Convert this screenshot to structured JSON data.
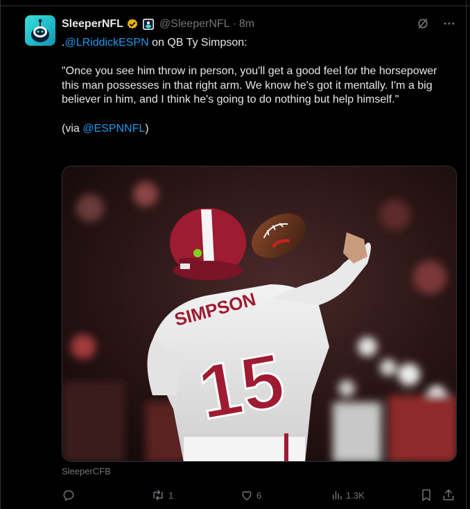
{
  "tweet": {
    "display_name": "SleeperNFL",
    "handle": "@SleeperNFL",
    "separator": "·",
    "time": "8m",
    "text_prefix": ".",
    "mention_1": "@LRiddickESPN",
    "text_line1_rest": " on QB Ty Simpson:",
    "quote": "\"Once you see him throw in person, you'll get a good feel for the horsepower this man possesses in that right arm. We know he's got it mentally. I'm a big believer in him, and I think he's going to do nothing but help himself.\"",
    "via_prefix": "(via ",
    "mention_2": "@ESPNNFL",
    "via_suffix": ")",
    "media_source": "SleeperCFB",
    "jersey_name": "SIMPSON",
    "jersey_number": "15"
  },
  "actions": {
    "reply_count": "",
    "retweet_count": "1",
    "like_count": "6",
    "view_count": "1.3K"
  },
  "icons": {
    "verified": "verified-gold-badge-icon",
    "affiliate": "affiliate-badge-icon",
    "grok": "grok-icon",
    "more": "more-icon",
    "reply": "reply-icon",
    "retweet": "retweet-icon",
    "like": "like-icon",
    "views": "views-icon",
    "bookmark": "bookmark-icon",
    "share": "share-icon"
  },
  "colors": {
    "background": "#000000",
    "text": "#e7e9ea",
    "muted": "#71767b",
    "link": "#1d9bf0",
    "verified": "#e8b400",
    "jersey_crimson": "#9e1b32"
  }
}
